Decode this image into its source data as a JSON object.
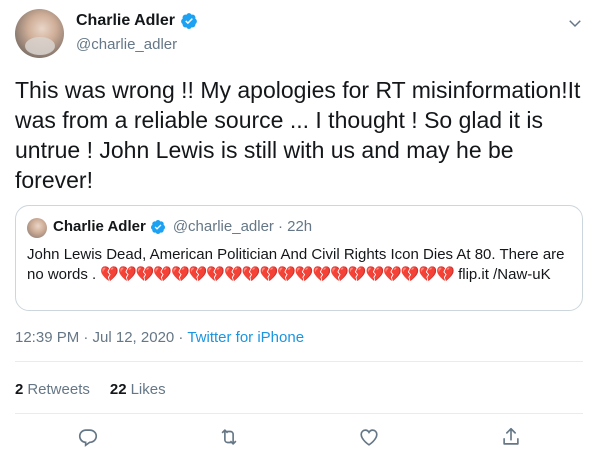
{
  "tweet": {
    "author": {
      "display_name": "Charlie Adler",
      "handle": "@charlie_adler"
    },
    "text": "This was wrong !! My apologies for RT misinformation!It was from a reliable source ... I thought ! So glad it is untrue ! John Lewis is still with us and may he be forever!",
    "timestamp": "12:39 PM · Jul 12, 2020",
    "meta_separator": " · ",
    "source": "Twitter for iPhone"
  },
  "quote": {
    "display_name": "Charlie Adler",
    "handle": "@charlie_adler",
    "time": "· 22h",
    "text_before": "John Lewis Dead, American Politician And Civil Rights Icon Dies At 80.    There are no words . ",
    "hearts": "💔💔💔💔💔💔💔💔💔💔💔💔💔💔💔💔💔💔💔💔",
    "text_after": " flip.it /Naw-uK"
  },
  "stats": {
    "retweets_count": "2",
    "retweets_label": "Retweets",
    "likes_count": "22",
    "likes_label": "Likes"
  },
  "icons": {
    "verified": "verified-badge-icon",
    "more": "chevron-down-icon",
    "reply": "reply-icon",
    "retweet": "retweet-icon",
    "like": "heart-icon",
    "share": "share-icon"
  },
  "colors": {
    "accent": "#1da1f2",
    "link": "#1b95e0",
    "secondary_text": "#657786",
    "broken_heart": "#e0245e"
  }
}
